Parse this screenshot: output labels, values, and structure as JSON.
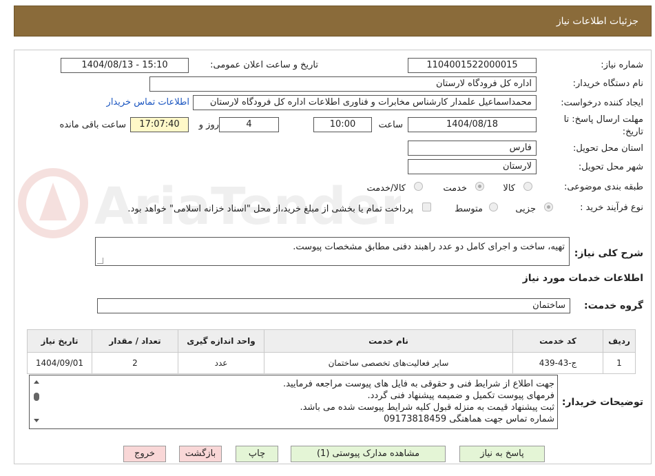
{
  "header": {
    "title": "جزئیات اطلاعات نیاز"
  },
  "fields": {
    "need_number_label": "شماره نیاز:",
    "need_number": "1104001522000015",
    "announce_label": "تاریخ و ساعت اعلان عمومی:",
    "announce_value": "1404/08/13 - 15:10",
    "buyer_org_label": "نام دستگاه خریدار:",
    "buyer_org": "اداره کل فرودگاه لارستان",
    "creator_label": "ایجاد کننده درخواست:",
    "creator": "محمداسماعیل علمدار کارشناس مخابرات و فناوری اطلاعات اداره کل فرودگاه لارستان",
    "contact_link": "اطلاعات تماس خریدار",
    "deadline_label_1": "مهلت ارسال پاسخ: تا",
    "deadline_label_2": "تاریخ:",
    "deadline_date": "1404/08/18",
    "time_label": "ساعت",
    "deadline_time": "10:00",
    "days_value": "4",
    "days_label": "روز و",
    "remaining_time": "17:07:40",
    "remaining_label": "ساعت باقی مانده",
    "province_label": "استان محل تحویل:",
    "province": "فارس",
    "city_label": "شهر محل تحویل:",
    "city": "لارستان",
    "category_label": "طبقه بندی موضوعی:",
    "category_options": [
      "کالا",
      "خدمت",
      "کالا/خدمت"
    ],
    "purchase_type_label": "نوع فرآیند خرید :",
    "purchase_options": [
      "جزیی",
      "متوسط"
    ],
    "payment_note": "پرداخت تمام یا بخشی از مبلغ خرید،از محل \"اسناد خزانه اسلامی\" خواهد بود."
  },
  "summary": {
    "label": "شرح کلی نیاز:",
    "text": "تهیه، ساخت و اجرای کامل دو عدد راهبند دفنی مطابق مشخصات پیوست."
  },
  "services": {
    "section_title": "اطلاعات خدمات مورد نیاز",
    "group_label": "گروه خدمت:",
    "group_value": "ساختمان",
    "columns": [
      "ردیف",
      "کد خدمت",
      "نام خدمت",
      "واحد اندازه گیری",
      "تعداد / مقدار",
      "تاریخ نیاز"
    ],
    "rows": [
      {
        "row": "1",
        "code": "ج-43-439",
        "name": "سایر فعالیت‌های تخصصی ساختمان",
        "unit": "عدد",
        "qty": "2",
        "date": "1404/09/01"
      }
    ]
  },
  "buyer_notes": {
    "label": "توضیحات خریدار:",
    "lines": [
      "جهت اطلاع از شرایط فنی و حقوقی به فایل های پیوست مراجعه فرمایید.",
      "فرمهای پیوست تکمیل و ضمیمه پیشنهاد فنی گردد.",
      "ثبت پیشنهاد قیمت به منزله قبول کلیه شرایط پیوست شده می باشد.",
      "شماره تماس جهت هماهنگی 09173818459"
    ]
  },
  "buttons": {
    "reply": "پاسخ به نیاز",
    "attachments": "مشاهده مدارک پیوستی (1)",
    "print": "چاپ",
    "back": "بازگشت",
    "exit": "خروج"
  },
  "watermark": {
    "text": "AriaTender.neT"
  },
  "colors": {
    "header": "#8a6b3a",
    "link": "#1a55c0",
    "button_green": "#e4f5d6",
    "button_pink": "#f9d7d7",
    "remaining_bg": "#fff8c8"
  }
}
